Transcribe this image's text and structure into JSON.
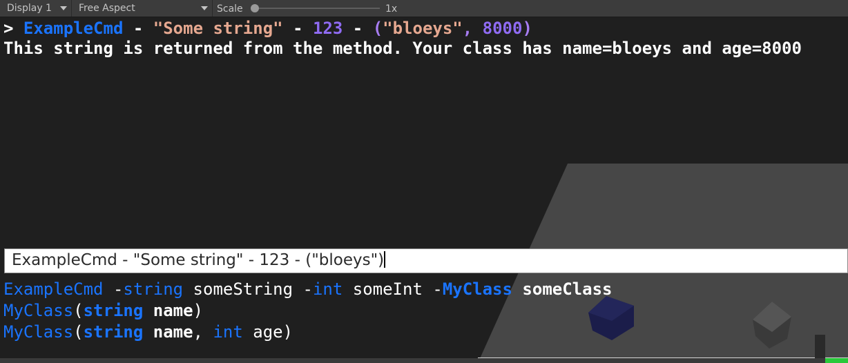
{
  "toolbar": {
    "display": "Display 1",
    "aspect": "Free Aspect",
    "scale_label": "Scale",
    "scale_value": "1x"
  },
  "console": {
    "prompt": ">",
    "command_name": "ExampleCmd",
    "sep1": "-",
    "arg_string": "\"Some string\"",
    "sep2": "-",
    "arg_int": "123",
    "sep3": "-",
    "arg_tuple_open": "(",
    "arg_tuple_name": "\"bloeys\"",
    "arg_tuple_comma": ",",
    "arg_tuple_age": "8000",
    "arg_tuple_close": ")",
    "output": "This string is returned from the method. Your class has name=bloeys and age=8000"
  },
  "input": {
    "value": "ExampleCmd - \"Some string\" - 123 - (\"bloeys\")"
  },
  "suggestions": [
    {
      "parts": [
        {
          "t": "ExampleCmd",
          "c": "blue",
          "b": false
        },
        {
          "t": " -",
          "c": "white",
          "b": false
        },
        {
          "t": "string",
          "c": "blue",
          "b": false
        },
        {
          "t": " someString -",
          "c": "white",
          "b": false
        },
        {
          "t": "int",
          "c": "blue",
          "b": false
        },
        {
          "t": " someInt -",
          "c": "white",
          "b": false
        },
        {
          "t": "MyClass",
          "c": "blue",
          "b": true
        },
        {
          "t": " someClass",
          "c": "white",
          "b": true
        }
      ]
    },
    {
      "parts": [
        {
          "t": "MyClass",
          "c": "blue",
          "b": false
        },
        {
          "t": "(",
          "c": "white",
          "b": false
        },
        {
          "t": "string",
          "c": "blue",
          "b": true
        },
        {
          "t": " name",
          "c": "white",
          "b": true
        },
        {
          "t": ")",
          "c": "white",
          "b": false
        }
      ]
    },
    {
      "parts": [
        {
          "t": "MyClass",
          "c": "blue",
          "b": false
        },
        {
          "t": "(",
          "c": "white",
          "b": false
        },
        {
          "t": "string",
          "c": "blue",
          "b": true
        },
        {
          "t": " name",
          "c": "white",
          "b": true
        },
        {
          "t": ", ",
          "c": "white",
          "b": false
        },
        {
          "t": "int",
          "c": "blue",
          "b": false
        },
        {
          "t": " age)",
          "c": "white",
          "b": false
        }
      ]
    }
  ],
  "colors": {
    "blue": "#1a74ff",
    "white": "#ffffff",
    "salmon": "#e6a890",
    "purple": "#8f6bf2"
  }
}
